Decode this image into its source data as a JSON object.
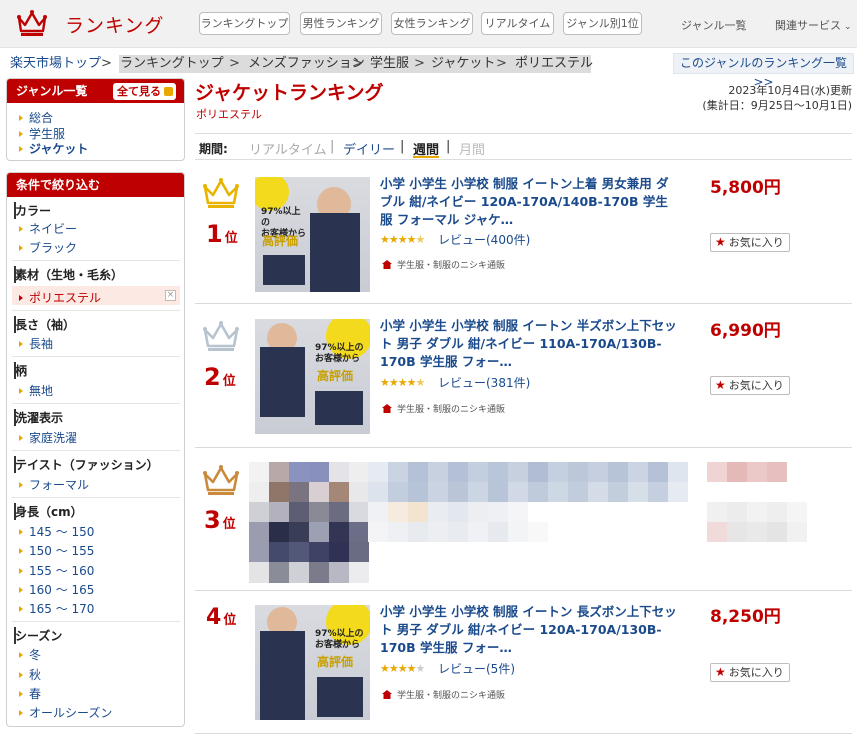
{
  "header": {
    "logo_text": "ランキング",
    "nav": [
      "ランキングトップ",
      "男性ランキング",
      "女性ランキング",
      "リアルタイム",
      "ジャンル別1位"
    ],
    "genre_list": "ジャンル一覧",
    "related": "関連サービス",
    "chevron": "⌄"
  },
  "breadcrumb": {
    "items": [
      "楽天市場トップ",
      "ランキングトップ",
      "メンズファッション",
      "学生服",
      "ジャケット",
      "ポリエステル"
    ],
    "sep": ">"
  },
  "genre_ranking_link": "このジャンルのランキング一覧 >>",
  "sidebar": {
    "genre_title": "ジャンル一覧",
    "see_all": "全て見る",
    "genres": [
      "総合",
      "学生服",
      "ジャケット"
    ],
    "filter_title": "条件で絞り込む",
    "filters": [
      {
        "head": "カラー",
        "items": [
          "ネイビー",
          "ブラック"
        ]
      },
      {
        "head": "素材（生地・毛糸）",
        "items": [
          "ポリエステル"
        ]
      },
      {
        "head": "長さ（袖）",
        "items": [
          "長袖"
        ]
      },
      {
        "head": "柄",
        "items": [
          "無地"
        ]
      },
      {
        "head": "洗濯表示",
        "items": [
          "家庭洗濯"
        ]
      },
      {
        "head": "テイスト（ファッション）",
        "items": [
          "フォーマル"
        ]
      },
      {
        "head": "身長（cm）",
        "items": [
          "145 ～ 150",
          "150 ～ 155",
          "155 ～ 160",
          "160 ～ 165",
          "165 ～ 170"
        ]
      },
      {
        "head": "シーズン",
        "items": [
          "冬",
          "秋",
          "春",
          "オールシーズン"
        ]
      }
    ],
    "selected_close": "×"
  },
  "main": {
    "title": "ジャケットランキング",
    "subtitle": "ポリエステル",
    "updated": "2023年10月4日(水)更新",
    "period_range": "(集計日：9月25日～10月1日)",
    "period_label": "期間:",
    "periods": [
      "リアルタイム",
      "デイリー",
      "週間",
      "月間"
    ],
    "period_sep": "|",
    "rank_suffix": "位",
    "fav_label": "お気に入り",
    "fav_icon": "★",
    "items": [
      {
        "rank": "1",
        "title": "小学 小学生 小学校 制服 イートン上着 男女兼用 ダブル 紺/ネイビー 120A-170A/140B-170B 学生服 フォーマル ジャケ…",
        "price": "5,800円",
        "stars": "★★★★★",
        "rating": 4.5,
        "review": "レビュー(400件)",
        "shop": "学生服・制服のニシキ通販",
        "crown_color": "#e8b400",
        "img_text1": "97%以上の",
        "img_text2": "お客様から",
        "img_text3": "高評価"
      },
      {
        "rank": "2",
        "title": "小学 小学生 小学校 制服 イートン 半ズボン上下セット 男子 ダブル 紺/ネイビー 110A-170A/130B-170B 学生服 フォー…",
        "price": "6,990円",
        "stars": "★★★★★",
        "rating": 4.5,
        "review": "レビュー(381件)",
        "shop": "学生服・制服のニシキ通販",
        "crown_color": "#b7c4cf",
        "img_text1": "97%以上の",
        "img_text2": "お客様から",
        "img_text3": "高評価"
      },
      {
        "rank": "3",
        "crown_color": "#c98a3c"
      },
      {
        "rank": "4",
        "title": "小学 小学生 小学校 制服 イートン 長ズボン上下セット 男子 ダブル 紺/ネイビー 120A-170A/130B-170B 学生服 フォー…",
        "price": "8,250円",
        "stars": "★★★★★",
        "rating": 4.0,
        "review": "レビュー(5件)",
        "shop": "学生服・制服のニシキ通販",
        "img_text1": "97%以上の",
        "img_text2": "お客様から",
        "img_text3": "高評価"
      }
    ]
  },
  "colors": {
    "brand": "#bf0000",
    "link": "#1a4a8c",
    "star": "#e8a800",
    "gold": "#e8b400",
    "silver": "#b7c4cf",
    "bronze": "#c98a3c"
  }
}
